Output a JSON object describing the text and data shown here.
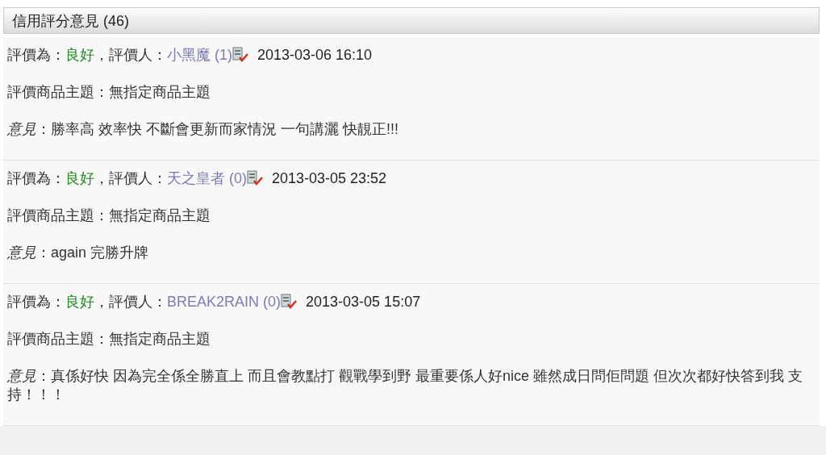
{
  "panel": {
    "title": "信用評分意見 (46)"
  },
  "reviews": [
    {
      "rating_label": "評價為：",
      "rating": "良好",
      "rater_label": "，評價人：",
      "rater": "小黑魔",
      "rater_score": "(1)",
      "date": "2013-03-06 16:10",
      "subject": "評價商品主題：無指定商品主題",
      "opinion": "*意見*：勝率高 效率快 不斷會更新而家情況 一句講灑 快靚正!!!"
    },
    {
      "rating_label": "評價為：",
      "rating": "良好",
      "rater_label": "，評價人：",
      "rater": "天之皇者",
      "rater_score": "(0)",
      "date": "2013-03-05 23:52",
      "subject": "評價商品主題：無指定商品主題",
      "opinion": "*意見*：again 完勝升牌"
    },
    {
      "rating_label": "評價為：",
      "rating": "良好",
      "rater_label": "，評價人：",
      "rater": "BREAK2RAIN",
      "rater_score": "(0)",
      "date": "2013-03-05 15:07",
      "subject": "評價商品主題：無指定商品主題",
      "opinion": "*意見*：真係好快 因為完全係全勝直上 而且會教點打 觀戰學到野 最重要係人好nice 雖然成日問佢問題 但次次都好快答到我 支持！！！"
    }
  ]
}
